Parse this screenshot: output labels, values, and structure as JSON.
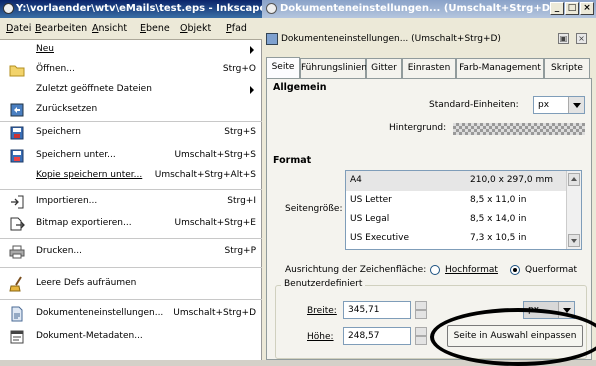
{
  "left_window": {
    "title": "Y:\\vorlaender\\wtv\\eMails\\test.eps - Inkscape",
    "menubar": [
      "Datei",
      "Bearbeiten",
      "Ansicht",
      "Ebene",
      "Objekt",
      "Pfad"
    ],
    "menu_items": [
      {
        "label": "Neu",
        "shortcut": "",
        "submenu": true,
        "icon": ""
      },
      {
        "label": "Öffnen...",
        "shortcut": "Strg+O",
        "icon": "folder-icon"
      },
      {
        "label": "Zuletzt geöffnete Dateien",
        "shortcut": "",
        "submenu": true,
        "icon": ""
      },
      {
        "label": "Zurücksetzen",
        "shortcut": "",
        "icon": "revert-icon"
      },
      {
        "label": "Speichern",
        "shortcut": "Strg+S",
        "icon": "save-icon"
      },
      {
        "label": "Speichern unter...",
        "shortcut": "Umschalt+Strg+S",
        "icon": "save-as-icon"
      },
      {
        "label": "Kopie speichern unter...",
        "shortcut": "Umschalt+Strg+Alt+S",
        "icon": ""
      },
      {
        "label": "Importieren...",
        "shortcut": "Strg+I",
        "icon": "import-icon"
      },
      {
        "label": "Bitmap exportieren...",
        "shortcut": "Umschalt+Strg+E",
        "icon": "export-icon"
      },
      {
        "label": "Drucken...",
        "shortcut": "Strg+P",
        "icon": "printer-icon"
      },
      {
        "label": "Leere Defs aufräumen",
        "shortcut": "",
        "icon": "broom-icon"
      },
      {
        "label": "Dokumenteneinstellungen...",
        "shortcut": "Umschalt+Strg+D",
        "icon": "document-settings-icon"
      },
      {
        "label": "Dokument-Metadaten...",
        "shortcut": "",
        "icon": "metadata-icon"
      }
    ]
  },
  "right_window": {
    "title": "Dokumenteneinstellungen... (Umschalt+Strg+D)",
    "dock_title": "Dokumenteneinstellungen... (Umschalt+Strg+D)",
    "window_buttons": [
      "_",
      "□",
      "×"
    ],
    "tabs": [
      "Seite",
      "Führungslinien",
      "Gitter",
      "Einrasten",
      "Farb-Management",
      "Skripte"
    ],
    "general_heading": "Allgemein",
    "units_label": "Standard-Einheiten:",
    "units_value": "px",
    "background_label": "Hintergrund:",
    "format_heading": "Format",
    "page_size_label": "Seitengröße:",
    "page_sizes": [
      {
        "name": "A4",
        "size": "210,0 x 297,0 mm"
      },
      {
        "name": "US Letter",
        "size": "8,5 x 11,0 in"
      },
      {
        "name": "US Legal",
        "size": "8,5 x 14,0 in"
      },
      {
        "name": "US Executive",
        "size": "7,3 x 10,5 in"
      }
    ],
    "orientation_label": "Ausrichtung der Zeichenfläche:",
    "orientation_options": [
      "Hochformat",
      "Querformat"
    ],
    "orientation_selected": "Querformat",
    "custom_group": "Benutzerdefiniert",
    "width_label": "Breite:",
    "width_value": "345,71",
    "height_label": "Höhe:",
    "height_value": "248,57",
    "custom_units_value": "px",
    "fit_button": "Seite in Auswahl einpassen"
  }
}
